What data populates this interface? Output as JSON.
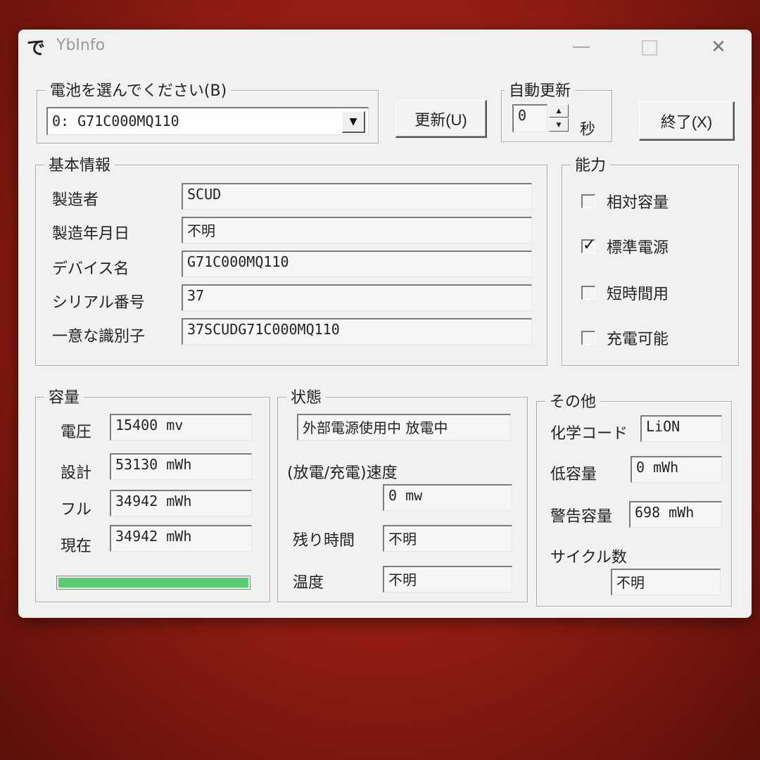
{
  "window": {
    "app_icon": "で",
    "title": "YbInfo",
    "close": "✕"
  },
  "battery_select": {
    "legend": "電池を選んでください(B)",
    "selected": "0: G71C000MQ110",
    "arrow": "▼"
  },
  "toolbar": {
    "update_label": "更新(U)",
    "auto_update_legend": "自動更新",
    "auto_update_value": "0",
    "seconds_label": "秒",
    "exit_label": "終了(X)"
  },
  "basic_info": {
    "legend": "基本情報",
    "rows": [
      {
        "label": "製造者",
        "value": "SCUD"
      },
      {
        "label": "製造年月日",
        "value": "不明"
      },
      {
        "label": "デバイス名",
        "value": "G71C000MQ110"
      },
      {
        "label": "シリアル番号",
        "value": "37"
      },
      {
        "label": "一意な識別子",
        "value": "37SCUDG71C000MQ110"
      }
    ]
  },
  "capability": {
    "legend": "能力",
    "items": [
      {
        "label": "相対容量",
        "checked": false
      },
      {
        "label": "標準電源",
        "checked": true
      },
      {
        "label": "短時間用",
        "checked": false
      },
      {
        "label": "充電可能",
        "checked": false
      }
    ]
  },
  "capacity": {
    "legend": "容量",
    "rows": [
      {
        "label": "電圧",
        "value": "15400 mv"
      },
      {
        "label": "設計",
        "value": "53130 mWh"
      },
      {
        "label": "フル",
        "value": "34942 mWh"
      },
      {
        "label": "現在",
        "value": "34942 mWh"
      }
    ],
    "charge_fraction": 1.0
  },
  "status": {
    "legend": "状態",
    "state": "外部電源使用中 放電中",
    "rate_label": "(放電/充電)速度",
    "rate_value": "0 mw",
    "remaining_label": "残り時間",
    "remaining_value": "不明",
    "temp_label": "温度",
    "temp_value": "不明"
  },
  "other": {
    "legend": "その他",
    "chem_label": "化学コード",
    "chem_value": "LiON",
    "low_label": "低容量",
    "low_value": "0 mWh",
    "warn_label": "警告容量",
    "warn_value": "698 mWh",
    "cycle_label": "サイクル数",
    "cycle_value": "不明"
  },
  "colors": {
    "progress": "#5acc73",
    "background": "#a3241a"
  }
}
